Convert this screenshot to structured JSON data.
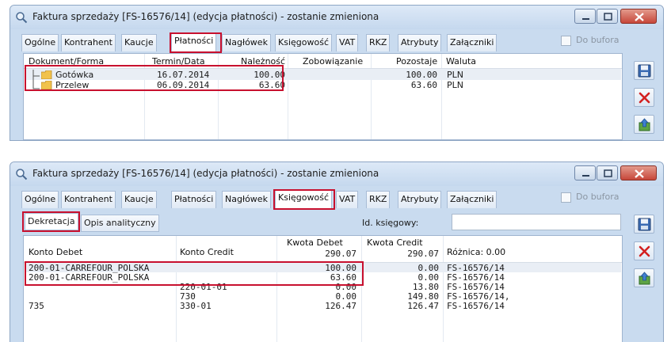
{
  "window1": {
    "title": "Faktura sprzedaży [FS-16576/14] (edycja płatności) - zostanie zmieniona",
    "tabs": [
      "Ogólne",
      "Kontrahent",
      "Kaucje",
      "Płatności",
      "Nagłówek",
      "Księgowość",
      "VAT",
      "RKZ",
      "Atrybuty",
      "Załączniki"
    ],
    "active_tab": "Płatności",
    "do_bufora_label": "Do bufora",
    "columns": {
      "dokument": "Dokument/Forma",
      "termin": "Termin/Data",
      "naleznosc": "Należność",
      "zobowiazanie": "Zobowiązanie",
      "pozostaje": "Pozostaje",
      "waluta": "Waluta"
    },
    "rows": [
      {
        "forma": "Gotówka",
        "termin": "16.07.2014",
        "naleznosc": "100.00",
        "zobowiazanie": "",
        "pozostaje": "100.00",
        "waluta": "PLN"
      },
      {
        "forma": "Przelew",
        "termin": "06.09.2014",
        "naleznosc": "63.60",
        "zobowiazanie": "",
        "pozostaje": "63.60",
        "waluta": "PLN"
      }
    ]
  },
  "window2": {
    "title": "Faktura sprzedaży [FS-16576/14] (edycja płatności) - zostanie zmieniona",
    "tabs": [
      "Ogólne",
      "Kontrahent",
      "Kaucje",
      "Płatności",
      "Nagłówek",
      "Księgowość",
      "VAT",
      "RKZ",
      "Atrybuty",
      "Załączniki"
    ],
    "active_tab": "Księgowość",
    "do_bufora_label": "Do bufora",
    "subtabs": [
      "Dekretacja",
      "Opis analityczny"
    ],
    "id_ksiegowy_label": "Id. księgowy:",
    "id_ksiegowy_value": "",
    "columns": {
      "konto_debet": "Konto Debet",
      "konto_credit": "Konto Credit",
      "kwota_debet": "Kwota Debet",
      "kwota_credit": "Kwota Credit",
      "roznica": "Różnica: 0.00"
    },
    "totals": {
      "debet": "290.07",
      "credit": "290.07"
    },
    "rows": [
      {
        "konto_debet": "200-01-CARREFOUR_POLSKA",
        "konto_credit": "",
        "kwota_debet": "100.00",
        "kwota_credit": "0.00",
        "opis": "FS-16576/14"
      },
      {
        "konto_debet": "200-01-CARREFOUR_POLSKA",
        "konto_credit": "",
        "kwota_debet": "63.60",
        "kwota_credit": "0.00",
        "opis": "FS-16576/14"
      },
      {
        "konto_debet": "",
        "konto_credit": "220-01-01",
        "kwota_debet": "0.00",
        "kwota_credit": "13.80",
        "opis": "FS-16576/14"
      },
      {
        "konto_debet": "",
        "konto_credit": "730",
        "kwota_debet": "0.00",
        "kwota_credit": "149.80",
        "opis": "FS-16576/14,"
      },
      {
        "konto_debet": "735",
        "konto_credit": "330-01",
        "kwota_debet": "126.47",
        "kwota_credit": "126.47",
        "opis": "FS-16576/14"
      }
    ]
  },
  "icons": {
    "app": "search-window-icon",
    "save": "save-icon",
    "delete": "delete-icon",
    "export": "export-icon",
    "folder": "folder-icon"
  },
  "colors": {
    "highlight_box": "#c8102e",
    "window_bg": "#c9dbef",
    "close_button": "#c7473a"
  }
}
